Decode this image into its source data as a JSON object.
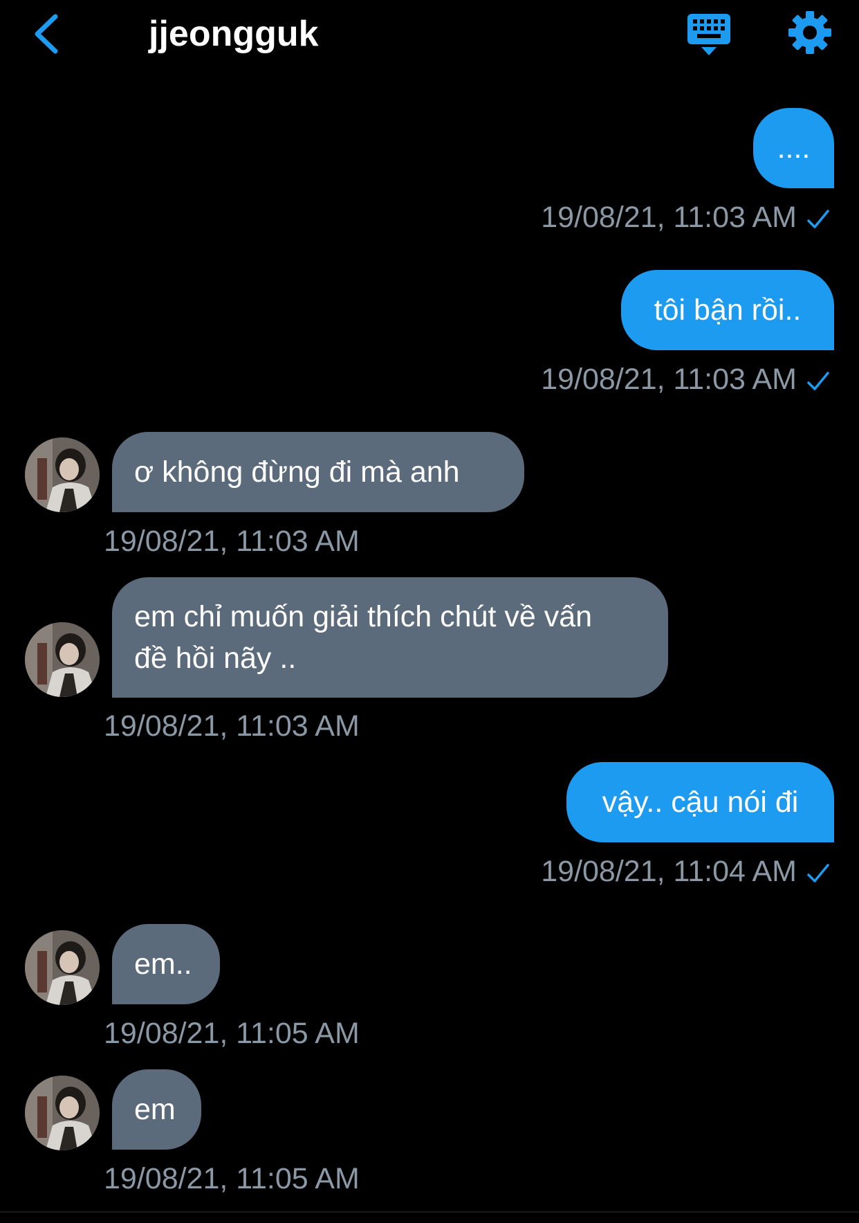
{
  "header": {
    "title": "jjeongguk",
    "back_icon": "chevron-left-icon",
    "keyboard_icon": "keyboard-icon",
    "settings_icon": "gear-icon"
  },
  "colors": {
    "background": "#000000",
    "accent": "#1d9bf0",
    "incoming_bubble": "#5b6b7c",
    "timestamp": "#8b98a5"
  },
  "messages": [
    {
      "direction": "outgoing",
      "text": "....",
      "time": "19/08/21, 11:03 AM",
      "read": true
    },
    {
      "direction": "outgoing",
      "text": "tôi bận rồi..",
      "time": "19/08/21, 11:03 AM",
      "read": true
    },
    {
      "direction": "incoming",
      "text": "ơ không đừng đi mà anh",
      "time": "19/08/21, 11:03 AM"
    },
    {
      "direction": "incoming",
      "text": "em chỉ muốn giải thích chút về vấn đề hồi nãy ..",
      "time": "19/08/21, 11:03 AM"
    },
    {
      "direction": "outgoing",
      "text": "vậy.. cậu nói đi",
      "time": "19/08/21, 11:04 AM",
      "read": true
    },
    {
      "direction": "incoming",
      "text": "em..",
      "time": "19/08/21, 11:05 AM"
    },
    {
      "direction": "incoming",
      "text": "em",
      "time": "19/08/21, 11:05 AM"
    }
  ]
}
